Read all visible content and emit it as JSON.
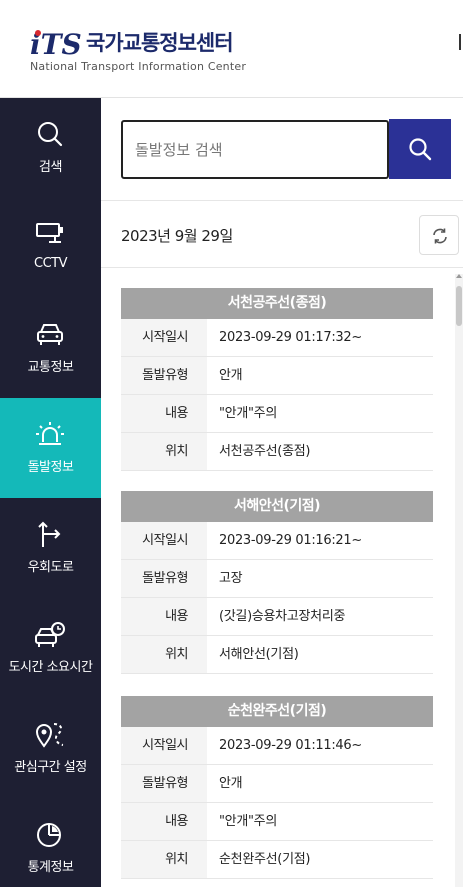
{
  "header": {
    "logo_mark": "iTS",
    "logo_title": "국가교통정보센터",
    "logo_subtitle": "National Transport Information Center"
  },
  "sidebar": {
    "items": [
      {
        "label": "검색",
        "icon": "search-icon",
        "active": false
      },
      {
        "label": "CCTV",
        "icon": "cctv-icon",
        "active": false
      },
      {
        "label": "교통정보",
        "icon": "car-icon",
        "active": false
      },
      {
        "label": "돌발정보",
        "icon": "alarm-icon",
        "active": true
      },
      {
        "label": "우회도로",
        "icon": "detour-icon",
        "active": false
      },
      {
        "label": "도시간 소요시간",
        "icon": "car-clock-icon",
        "active": false
      },
      {
        "label": "관심구간 설정",
        "icon": "route-pin-icon",
        "active": false
      },
      {
        "label": "통계정보",
        "icon": "pie-chart-icon",
        "active": false
      }
    ]
  },
  "search": {
    "value": "",
    "placeholder": "돌발정보 검색"
  },
  "date": {
    "text": "2023년 9월 29일"
  },
  "labels": {
    "start": "시작일시",
    "type": "돌발유형",
    "content": "내용",
    "location": "위치"
  },
  "incidents": [
    {
      "title": "서천공주선(종점)",
      "start": "2023-09-29  01:17:32~",
      "type": "안개",
      "content": "\"안개\"주의",
      "location": "서천공주선(종점)"
    },
    {
      "title": "서해안선(기점)",
      "start": "2023-09-29  01:16:21~",
      "type": "고장",
      "content": "(갓길)승용차고장처리중",
      "location": "서해안선(기점)"
    },
    {
      "title": "순천완주선(기점)",
      "start": "2023-09-29  01:11:46~",
      "type": "안개",
      "content": "\"안개\"주의",
      "location": "순천완주선(기점)"
    }
  ],
  "colors": {
    "sidebar_bg": "#1e1f33",
    "active": "#14b9b9",
    "search_button": "#2b3196",
    "card_header": "#a3a3a3",
    "logo_red": "#d7282f",
    "logo_navy": "#1c2a6b"
  }
}
